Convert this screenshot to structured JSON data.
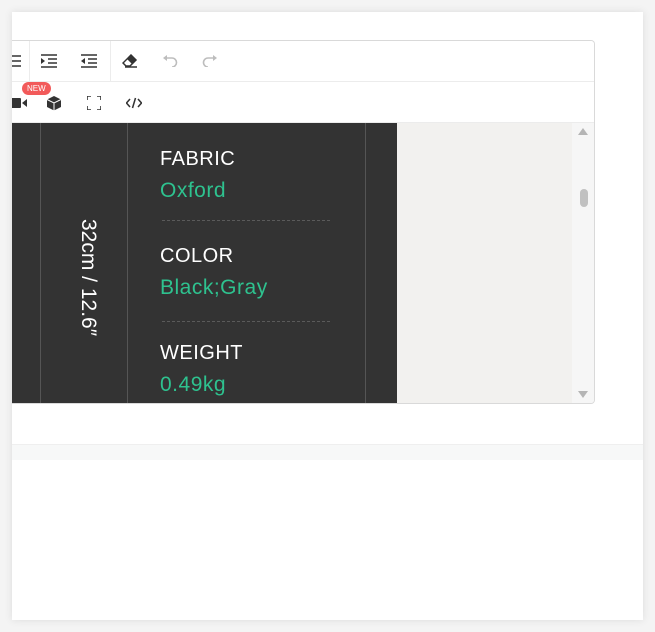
{
  "toolbar": {
    "new_badge": "NEW",
    "row1_icons": [
      "list-icon",
      "indent-icon",
      "outdent-icon",
      "clear-format-icon",
      "undo-icon",
      "redo-icon"
    ],
    "row2_icons": [
      "video-icon",
      "cube-icon",
      "fullscreen-icon",
      "code-view-icon"
    ]
  },
  "content": {
    "dimension": "32cm  / 12.6″",
    "specs": [
      {
        "label": "FABRIC",
        "value": "Oxford"
      },
      {
        "label": "COLOR",
        "value": "Black;Gray"
      },
      {
        "label": "WEIGHT",
        "value": "0.49kg"
      }
    ]
  },
  "colors": {
    "dark_panel": "#333333",
    "value_accent": "#2ec28f",
    "badge": "#f25a5a"
  }
}
